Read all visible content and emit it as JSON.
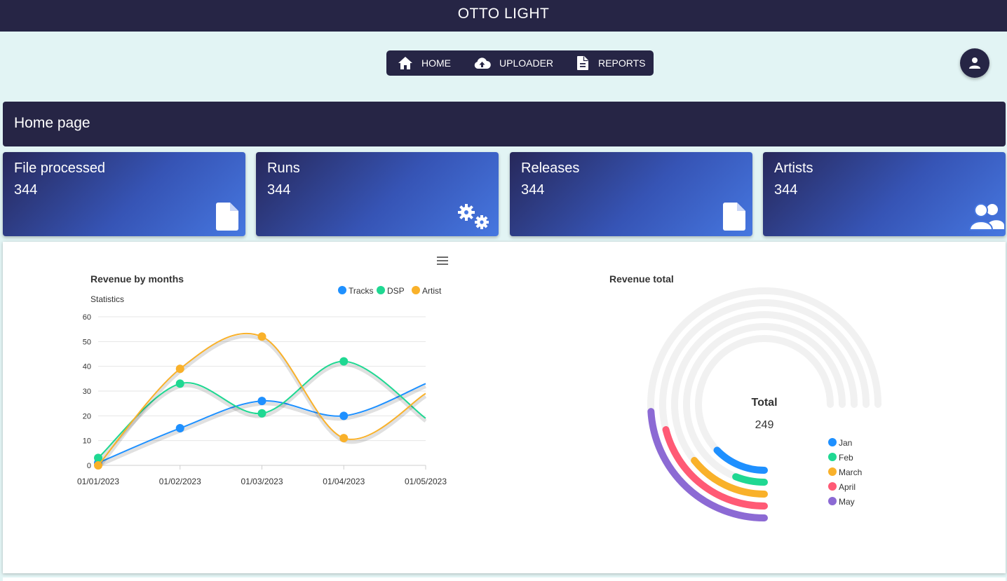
{
  "app": {
    "title": "OTTO LIGHT"
  },
  "nav": {
    "items": [
      {
        "label": "HOME",
        "icon": "home-icon"
      },
      {
        "label": "UPLOADER",
        "icon": "cloud-upload-icon"
      },
      {
        "label": "REPORTS",
        "icon": "document-icon"
      }
    ]
  },
  "page": {
    "title": "Home page"
  },
  "cards": [
    {
      "title": "File processed",
      "value": "344",
      "icon": "file-icon"
    },
    {
      "title": "Runs",
      "value": "344",
      "icon": "gears-icon"
    },
    {
      "title": "Releases",
      "value": "344",
      "icon": "file-icon"
    },
    {
      "title": "Artists",
      "value": "344",
      "icon": "users-icon"
    }
  ],
  "colors": {
    "navy": "#262545",
    "tracks": "#1e90ff",
    "dsp": "#1fd892",
    "artist": "#f9b12a",
    "apr": "#ff5a75",
    "may": "#8c6ad4",
    "track_bg": "#f1f1f1"
  },
  "chart_data": [
    {
      "type": "line",
      "title": "Revenue by months",
      "subtitle": "Statistics",
      "categories": [
        "01/01/2023",
        "01/02/2023",
        "01/03/2023",
        "01/04/2023",
        "01/05/2023"
      ],
      "series": [
        {
          "name": "Tracks",
          "color": "#1e90ff",
          "values": [
            1,
            15,
            26,
            20,
            33
          ]
        },
        {
          "name": "DSP",
          "color": "#1fd892",
          "values": [
            3,
            33,
            21,
            42,
            19
          ]
        },
        {
          "name": "Artist",
          "color": "#f9b12a",
          "values": [
            0,
            39,
            52,
            11,
            29
          ]
        }
      ],
      "ylim": [
        0,
        60
      ],
      "yticks": [
        "60",
        "50",
        "40",
        "30",
        "20",
        "10",
        "0"
      ],
      "legend": "top-right",
      "grid": true
    },
    {
      "type": "radialBar",
      "title": "Revenue total",
      "total_label": "Total",
      "total_value": "249",
      "series": [
        {
          "name": "Jan",
          "color": "#1e90ff",
          "value": 0.17
        },
        {
          "name": "Feb",
          "color": "#1fd892",
          "value": 0.08
        },
        {
          "name": "March",
          "color": "#f9b12a",
          "value": 0.19
        },
        {
          "name": "April",
          "color": "#ff5a75",
          "value": 0.28
        },
        {
          "name": "May",
          "color": "#8c6ad4",
          "value": 0.32
        }
      ],
      "legend": "bottom-right"
    }
  ]
}
